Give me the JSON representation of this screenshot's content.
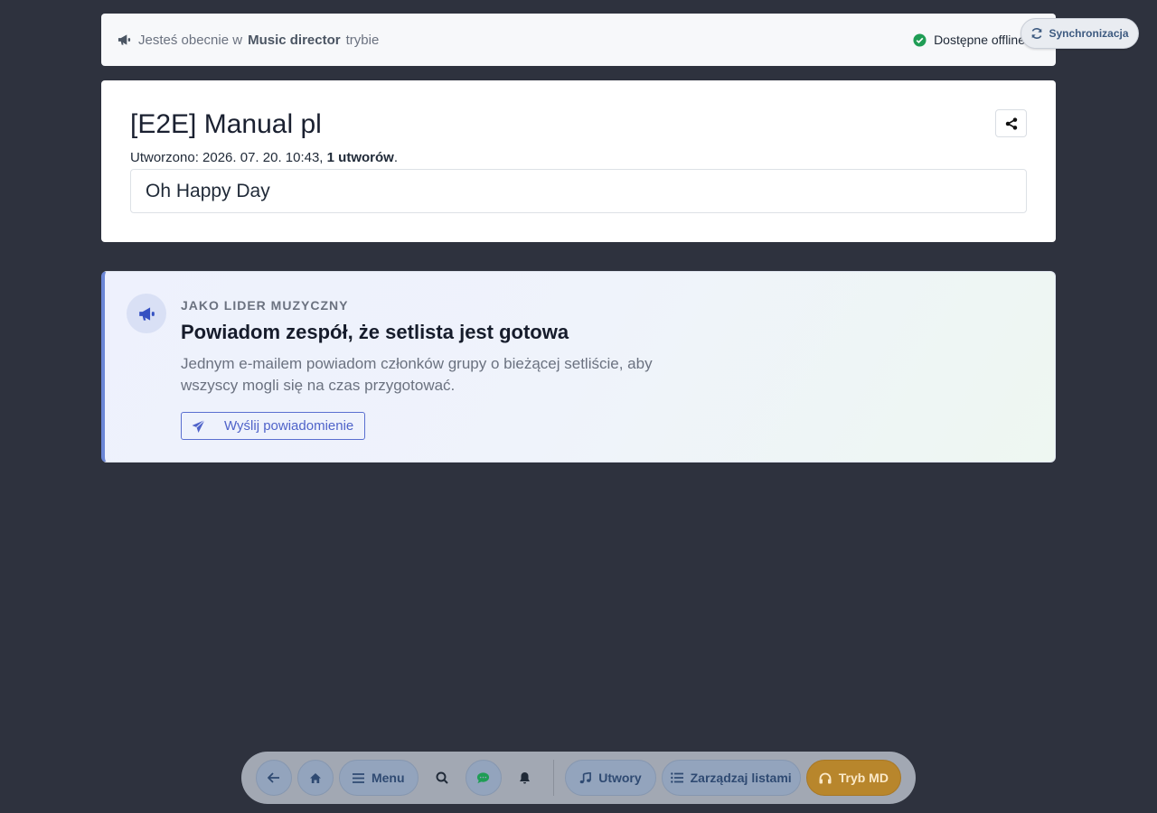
{
  "mode_bar": {
    "prefix": "Jesteś obecnie w",
    "mode": "Music director",
    "suffix": "trybie",
    "offline": "Dostępne offline"
  },
  "sync": {
    "label": "Synchronizacja"
  },
  "setlist": {
    "title": "[E2E] Manual pl",
    "created_prefix": "Utworzono: 2026. 07. 20. 10:43,",
    "count": "1 utworów",
    "count_suffix": ".",
    "songs": [
      "Oh Happy Day"
    ]
  },
  "notify": {
    "eyebrow": "JAKO LIDER MUZYCZNY",
    "heading": "Powiadom zespół, że setlista jest gotowa",
    "description": "Jednym e-mailem powiadom członków grupy o bieżącej setliście, aby wszyscy mogli się na czas przygotować.",
    "button": "Wyślij powiadomienie"
  },
  "dock": {
    "menu": "Menu",
    "songs": "Utwory",
    "manage": "Zarządzaj listami",
    "md_mode": "Tryb MD"
  },
  "colors": {
    "background": "#2e323e",
    "accent": "#4f63c9",
    "md_button": "#b8862c",
    "offline_check": "#1f9d55"
  }
}
